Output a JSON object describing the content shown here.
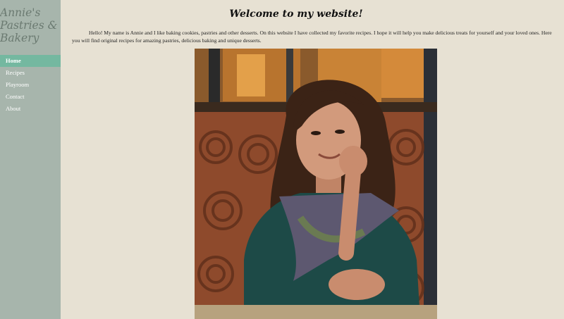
{
  "site": {
    "logo_text": "Annie's\nPastries &\nBakery"
  },
  "nav": {
    "items": [
      {
        "label": "Home",
        "active": true
      },
      {
        "label": "Recipes",
        "active": false
      },
      {
        "label": "Playroom",
        "active": false
      },
      {
        "label": "Contact",
        "active": false
      },
      {
        "label": "About",
        "active": false
      }
    ]
  },
  "main": {
    "title": "Welcome to my website!",
    "intro": "Hello! My name is Annie and I like baking cookies, pastries and other desserts. On this website I have collected my favorite recipes. I hope it will help you make delicious treats for yourself and your loved ones. Here you will find original recipes for amazing pastries, delicious baking and unique desserts."
  },
  "colors": {
    "background": "#e7e1d3",
    "sidebar": "#a7b5ac",
    "nav_active": "#74b8a0"
  }
}
